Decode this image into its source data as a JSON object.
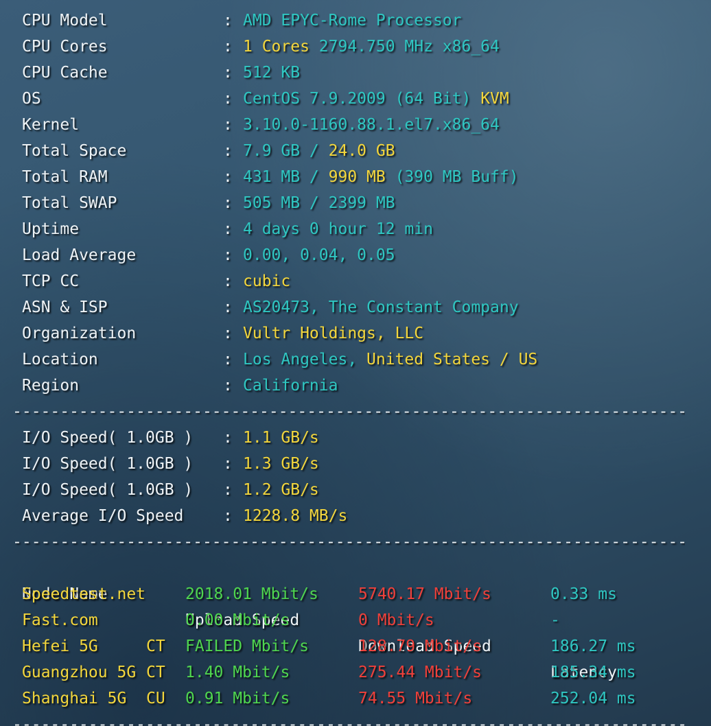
{
  "system": [
    {
      "label": "CPU Model",
      "parts": [
        {
          "t": "AMD EPYC-Rome Processor",
          "c": "cyan"
        }
      ]
    },
    {
      "label": "CPU Cores",
      "parts": [
        {
          "t": "1 Cores",
          "c": "yellow"
        },
        {
          "t": " 2794.750 MHz x86_64",
          "c": "cyan"
        }
      ]
    },
    {
      "label": "CPU Cache",
      "parts": [
        {
          "t": "512 KB",
          "c": "cyan"
        }
      ]
    },
    {
      "label": "OS",
      "parts": [
        {
          "t": "CentOS 7.9.2009 (64 Bit) ",
          "c": "cyan"
        },
        {
          "t": "KVM",
          "c": "yellow"
        }
      ]
    },
    {
      "label": "Kernel",
      "parts": [
        {
          "t": "3.10.0-1160.88.1.el7.x86_64",
          "c": "cyan"
        }
      ]
    },
    {
      "label": "Total Space",
      "parts": [
        {
          "t": "7.9 GB / ",
          "c": "cyan"
        },
        {
          "t": "24.0 GB",
          "c": "yellow"
        }
      ]
    },
    {
      "label": "Total RAM",
      "parts": [
        {
          "t": "431 MB / ",
          "c": "cyan"
        },
        {
          "t": "990 MB",
          "c": "yellow"
        },
        {
          "t": " (390 MB Buff)",
          "c": "cyan"
        }
      ]
    },
    {
      "label": "Total SWAP",
      "parts": [
        {
          "t": "505 MB / 2399 MB",
          "c": "cyan"
        }
      ]
    },
    {
      "label": "Uptime",
      "parts": [
        {
          "t": "4 days 0 hour 12 min",
          "c": "cyan"
        }
      ]
    },
    {
      "label": "Load Average",
      "parts": [
        {
          "t": "0.00, 0.04, 0.05",
          "c": "cyan"
        }
      ]
    },
    {
      "label": "TCP CC",
      "parts": [
        {
          "t": "cubic",
          "c": "yellow"
        }
      ]
    },
    {
      "label": "ASN & ISP",
      "parts": [
        {
          "t": "AS20473, The Constant Company",
          "c": "cyan"
        }
      ]
    },
    {
      "label": "Organization",
      "parts": [
        {
          "t": "Vultr Holdings, LLC",
          "c": "yellow"
        }
      ]
    },
    {
      "label": "Location",
      "parts": [
        {
          "t": "Los Angeles, ",
          "c": "cyan"
        },
        {
          "t": "United States / US",
          "c": "yellow"
        }
      ]
    },
    {
      "label": "Region",
      "parts": [
        {
          "t": "California",
          "c": "cyan"
        }
      ]
    }
  ],
  "io": [
    {
      "label": "I/O Speed( 1.0GB )",
      "value": "1.1 GB/s"
    },
    {
      "label": "I/O Speed( 1.0GB )",
      "value": "1.3 GB/s"
    },
    {
      "label": "I/O Speed( 1.0GB )",
      "value": "1.2 GB/s"
    },
    {
      "label": "Average I/O Speed",
      "value": "1228.8 MB/s"
    }
  ],
  "separator": "--------------------------------------------------------------------------",
  "colon": ":",
  "speedtest": {
    "headers": [
      "Node Name",
      "Upload Speed",
      "Download Speed",
      "Latency"
    ],
    "rows": [
      {
        "node": "Speedtest.net",
        "isp": "",
        "upload": "2018.01 Mbit/s",
        "download": "5740.17 Mbit/s",
        "latency": "0.33 ms"
      },
      {
        "node": "Fast.com",
        "isp": "",
        "upload": "0.00 Mbit/s",
        "download": "0 Mbit/s",
        "latency": "-"
      },
      {
        "node": "Hefei 5G",
        "isp": "CT",
        "upload": "FAILED Mbit/s",
        "download": "128.79 Mbit/s",
        "latency": "186.27 ms"
      },
      {
        "node": "Guangzhou 5G",
        "isp": "CT",
        "upload": "1.40 Mbit/s",
        "download": "275.44 Mbit/s",
        "latency": "185.34 ms"
      },
      {
        "node": "Shanghai 5G",
        "isp": "CU",
        "upload": "0.91 Mbit/s",
        "download": "74.55 Mbit/s",
        "latency": "252.04 ms"
      }
    ]
  },
  "colors": {
    "cyan": "#2fc7c2",
    "yellow": "#f3d63c",
    "green": "#4fd64f",
    "red": "#f0403a",
    "label": "#eef3f6"
  }
}
